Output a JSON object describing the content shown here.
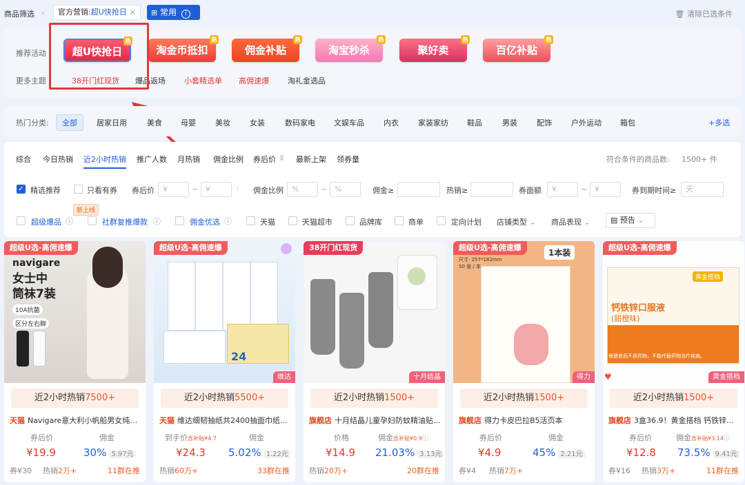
{
  "topbar": {
    "crumb": "商品筛选",
    "chip_label": "官方营销:",
    "chip_value": "超U快抢日",
    "common_label": "常用",
    "clear_label": "清除已选条件"
  },
  "promo": {
    "label": "推荐活动",
    "more_label": "更多主题",
    "items": [
      {
        "label": "超U快抢日",
        "hot": "热"
      },
      {
        "label": "淘金币抵扣",
        "hot": "热"
      },
      {
        "label": "佣金补贴",
        "hot": "热"
      },
      {
        "label": "淘宝秒杀",
        "hot": "热"
      },
      {
        "label": "聚好卖",
        "hot": "热"
      },
      {
        "label": "百亿补贴",
        "hot": "热"
      }
    ],
    "themes": [
      "38开门红现货",
      "爆品返场",
      "小套精选单",
      "高佣速爆",
      "淘礼金选品"
    ]
  },
  "categories": {
    "label": "热门分类:",
    "items": [
      "全部",
      "居家日用",
      "美食",
      "母婴",
      "美妆",
      "女装",
      "数码家电",
      "文娱车品",
      "内衣",
      "家装家纺",
      "鞋品",
      "男装",
      "配饰",
      "户外运动",
      "箱包"
    ],
    "more": "+多选"
  },
  "sort": {
    "items": [
      "综合",
      "今日热销",
      "近2小时热销",
      "推广人数",
      "月热销",
      "佣金比例",
      "券后价",
      "最新上架",
      "领券量"
    ],
    "result_label": "符合条件的商品数:",
    "result_count": "1500+ 件"
  },
  "filters": {
    "row1": {
      "chk1": "精选推荐",
      "chk2": "只看有券",
      "after_coupon": "券后价",
      "yen": "¥",
      "tilde": "~",
      "commission_ratio": "佣金比例",
      "pct": "%",
      "commission": "佣金≥",
      "sales": "热销≥",
      "coupon_amount": "券面额",
      "expire": "券到期时间≥",
      "day": "天"
    },
    "row2": {
      "new_tag": "新上线",
      "a": "超级爆品",
      "b": "社群复推爆款",
      "c": "佣金优选",
      "d": "天猫",
      "e": "天猫超市",
      "f": "品牌库",
      "g": "商单",
      "h": "定向计划",
      "i": "店铺类型",
      "j": "商品表现",
      "k": "预告"
    }
  },
  "cards": [
    {
      "tag": "超级U选-高佣速爆",
      "hot_prefix": "近2小时热销",
      "hot": "7500+",
      "shop": "天猫",
      "title": "Navigare意大利小帆船男女纯色...",
      "l1": "券后价",
      "l2": "佣金",
      "price": "¥19.9",
      "comm": "30%",
      "old": "5.97元",
      "f1": "券¥30",
      "f2": "热销",
      "f2v": "2万+",
      "f3": "11群在推",
      "corner": "",
      "img_text": "女士中筒袜7装",
      "img_sub": "10A抗菌",
      "img_sub2": "区分左右脚",
      "img_brand": "navigare"
    },
    {
      "tag": "超级U选-高佣速爆",
      "hot_prefix": "近2小时热销",
      "hot": "5500+",
      "shop": "天猫",
      "title": "维达细韧抽纸共2400抽面巾纸...",
      "l1": "到手价",
      "l1s": "含补贴¥4.7",
      "l2": "佣金",
      "price": "¥24.3",
      "comm": "5.02%",
      "old": "1.22元",
      "f1": "热销",
      "f1v": "60万+",
      "f3": "33群在推",
      "corner": "维达",
      "img_text": "24"
    },
    {
      "tag": "38开门红现货",
      "hot_prefix": "近2小时热销",
      "hot": "1500+",
      "shop": "旗舰店",
      "title": "十月结晶儿童孕妇防蚊精油贴...",
      "l1": "价格",
      "l2": "佣金",
      "l2s": "含补贴¥0.9",
      "price": "¥14.9",
      "comm": "21.03%",
      "old": "3.13元",
      "f1": "热销",
      "f1v": "20万+",
      "f3": "20群在推",
      "corner": "十月结晶"
    },
    {
      "tag": "超级U选-高佣速爆",
      "hot_prefix": "近2小时热销",
      "hot": "1500+",
      "shop": "旗舰店",
      "title": "得力卡皮巴拉B5活页本",
      "l1": "券后价",
      "l2": "佣金",
      "price": "¥4.9",
      "comm": "45%",
      "old": "2.21元",
      "f1": "券¥4",
      "f2": "热销",
      "f2v": "7万+",
      "f3": "",
      "corner": "得力",
      "img_text": "1本装",
      "img_sub": "尺寸: 257*182mm",
      "img_sub2": "50 张 / 本"
    },
    {
      "tag": "超级U选-高佣速爆",
      "hot_prefix": "近2小时热销",
      "hot": "1500+",
      "shop": "旗舰店",
      "title": "3盒36.9！黄金搭档 钙铁锌口...",
      "l1": "券后价",
      "l2": "佣金",
      "l2s": "含补贴¥3.14",
      "price": "¥12.8",
      "comm": "73.5%",
      "old": "9.41元",
      "f1": "券¥16",
      "f2": "热销",
      "f2v": "3万+",
      "f3": "11群在推",
      "corner": "黄金搭档",
      "img_text": "钙铁锌口服液",
      "img_sub": "(甜橙味)",
      "img_brand": "黄金搭档",
      "img_note": "保健食品不是药物，不能代替药物治疗疾病。"
    }
  ],
  "colors": {
    "accent": "#1f5ed8",
    "price": "#e8342a",
    "annotation": "#e0383d"
  }
}
